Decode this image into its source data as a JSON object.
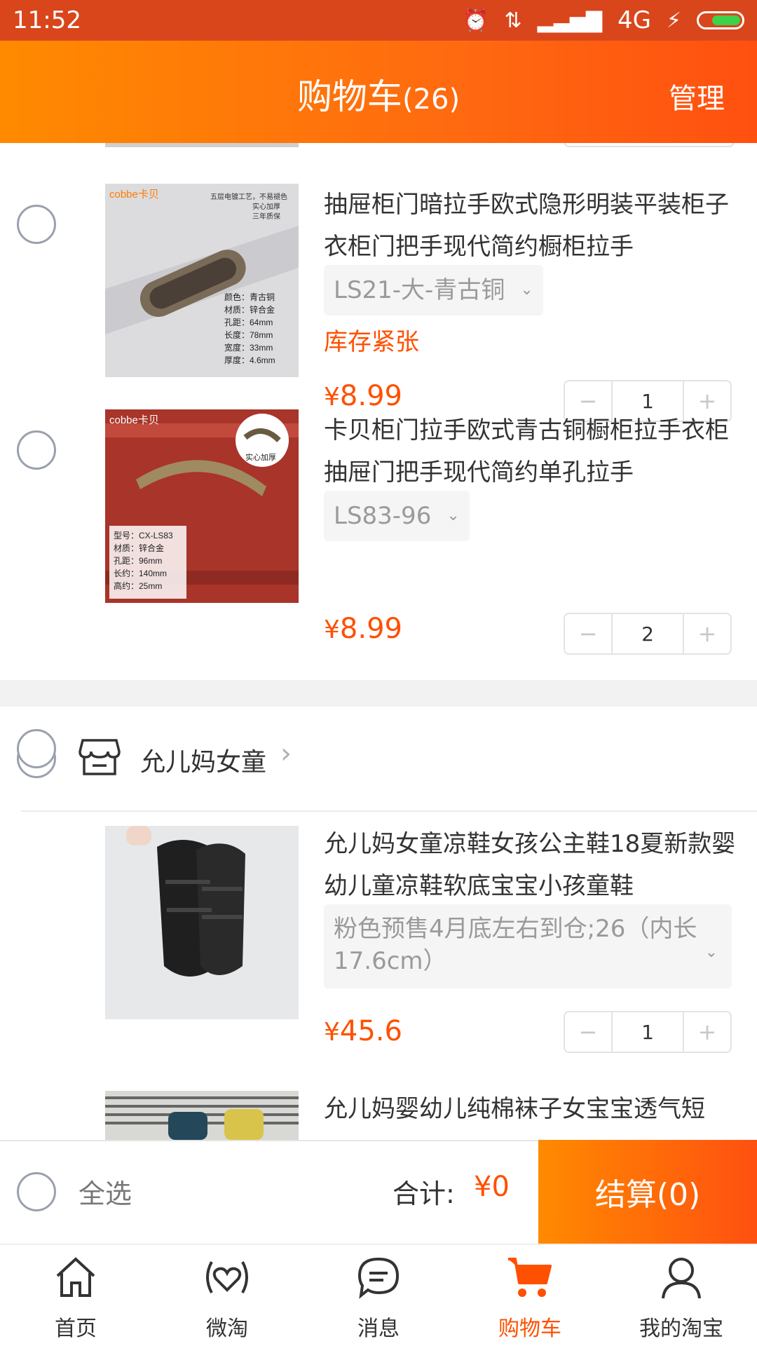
{
  "status_bar": {
    "time": "11:52",
    "network": "4G"
  },
  "header": {
    "title": "购物车",
    "count": "(26)",
    "manage": "管理"
  },
  "shop2": {
    "name": "允儿妈女童"
  },
  "items": [
    {
      "title": "抽屉柜门暗拉手欧式隐形明装平装柜子衣柜门把手现代简约橱柜拉手",
      "sku": "LS21-大-青古铜",
      "stock": "库存紧张",
      "price_symbol": "¥",
      "price_int": "8.",
      "price_dec": "99",
      "qty": "1",
      "thumb_brand": "cobbe卡贝",
      "thumb_note": "五层电镀工艺，不易褪色 实心加厚 三年质保",
      "thumb_specs": [
        "颜色：青古铜",
        "材质：锌合金",
        "孔距：64mm",
        "长度：78mm",
        "宽度：33mm",
        "厚度：4.6mm"
      ]
    },
    {
      "title": "卡贝柜门拉手欧式青古铜橱柜拉手衣柜抽屉门把手现代简约单孔拉手",
      "sku": "LS83-96",
      "price_symbol": "¥",
      "price_int": "8.",
      "price_dec": "99",
      "qty": "2",
      "thumb_brand": "cobbe卡贝",
      "thumb_badge": "实心加厚",
      "thumb_specs": [
        "型号：CX-LS83",
        "材质：锌合金",
        "孔距：96mm",
        "长约：140mm",
        "高约：25mm"
      ]
    },
    {
      "title": "允儿妈女童凉鞋女孩公主鞋18夏新款婴幼儿童凉鞋软底宝宝小孩童鞋",
      "sku": "粉色预售4月底左右到仓;26（内长17.6cm）",
      "price_symbol": "¥",
      "price_int": "45.",
      "price_dec": "6",
      "qty": "1"
    },
    {
      "title": "允儿妈婴幼儿纯棉袜子女宝宝透气短"
    }
  ],
  "checkout": {
    "select_all": "全选",
    "total_label": "合计:",
    "total_value": "¥0",
    "pay_button": "结算(0)"
  },
  "tabs": [
    {
      "label": "首页",
      "icon": "home-icon"
    },
    {
      "label": "微淘",
      "icon": "weitao-heart-icon"
    },
    {
      "label": "消息",
      "icon": "message-icon"
    },
    {
      "label": "购物车",
      "icon": "cart-icon"
    },
    {
      "label": "我的淘宝",
      "icon": "user-icon"
    }
  ],
  "colors": {
    "accent": "#ff5000",
    "header_start": "#ff8a00",
    "header_end": "#ff5010",
    "status_bar": "#d9461c"
  }
}
